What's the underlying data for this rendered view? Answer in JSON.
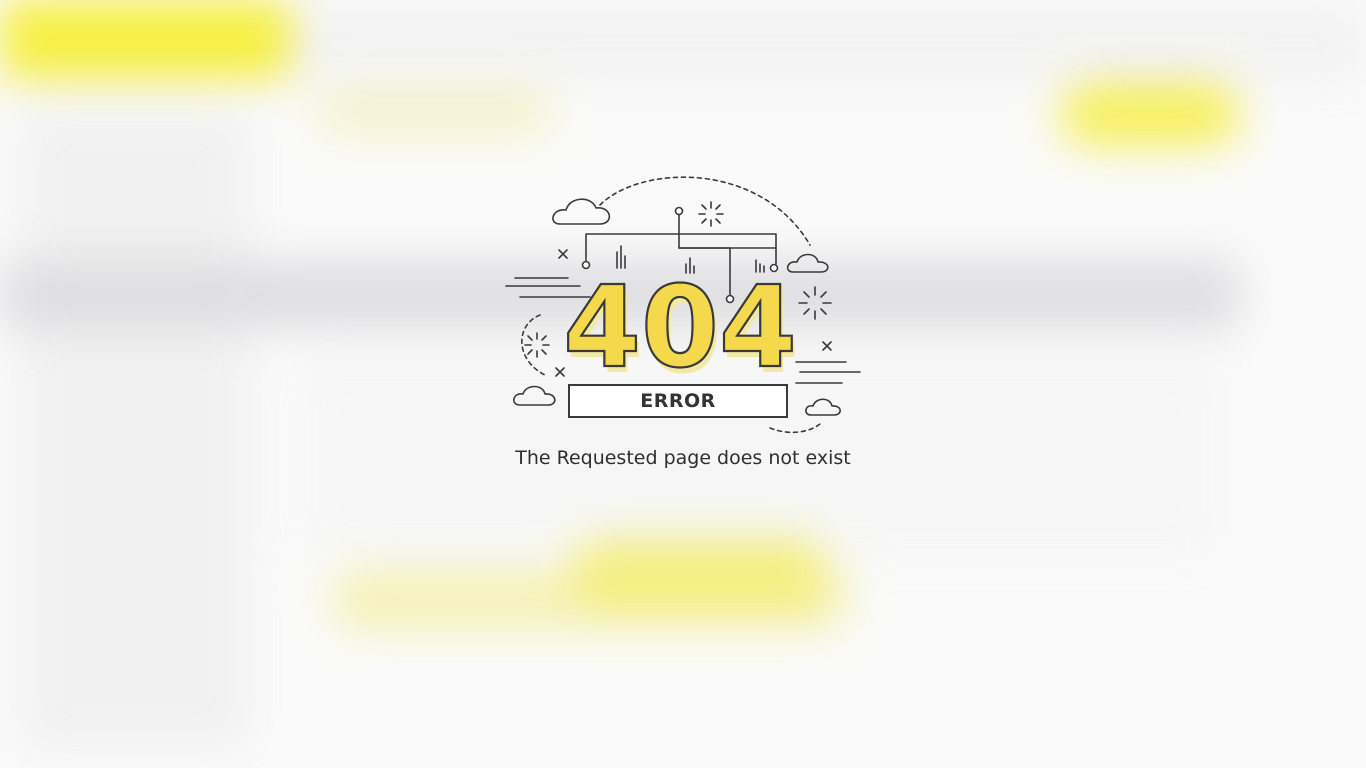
{
  "error": {
    "code": "404",
    "label": "ERROR",
    "message": "The Requested page does not exist"
  },
  "colors": {
    "accent": "#f5d94c",
    "outline": "#3a3a3a",
    "background": "#fafafa"
  }
}
